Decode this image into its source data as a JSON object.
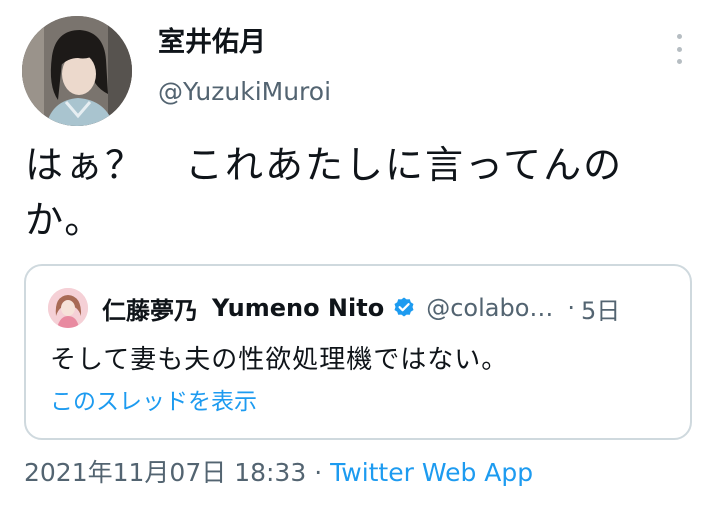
{
  "author": {
    "display_name": "室井佑月",
    "handle": "@YuzukiMuroi",
    "avatar_icon": "profile-photo"
  },
  "tweet": {
    "text": "はぁ？　これあたしに言ってんの\nか。"
  },
  "quoted_tweet": {
    "name_ja": "仁藤夢乃",
    "name_en": "Yumeno Nito",
    "verified_icon": "verified-badge-icon",
    "handle": "@colabo…",
    "separator": "·",
    "time": "5日",
    "text": "そして妻も夫の性欲処理機ではない。",
    "show_thread": "このスレッドを表示"
  },
  "meta": {
    "timestamp": "2021年11月07日 18:33",
    "separator": "·",
    "app": "Twitter Web App"
  },
  "colors": {
    "link": "#1d9bf0",
    "secondary_text": "#536471",
    "border": "#cfd9de",
    "verified": "#1d9bf0"
  }
}
